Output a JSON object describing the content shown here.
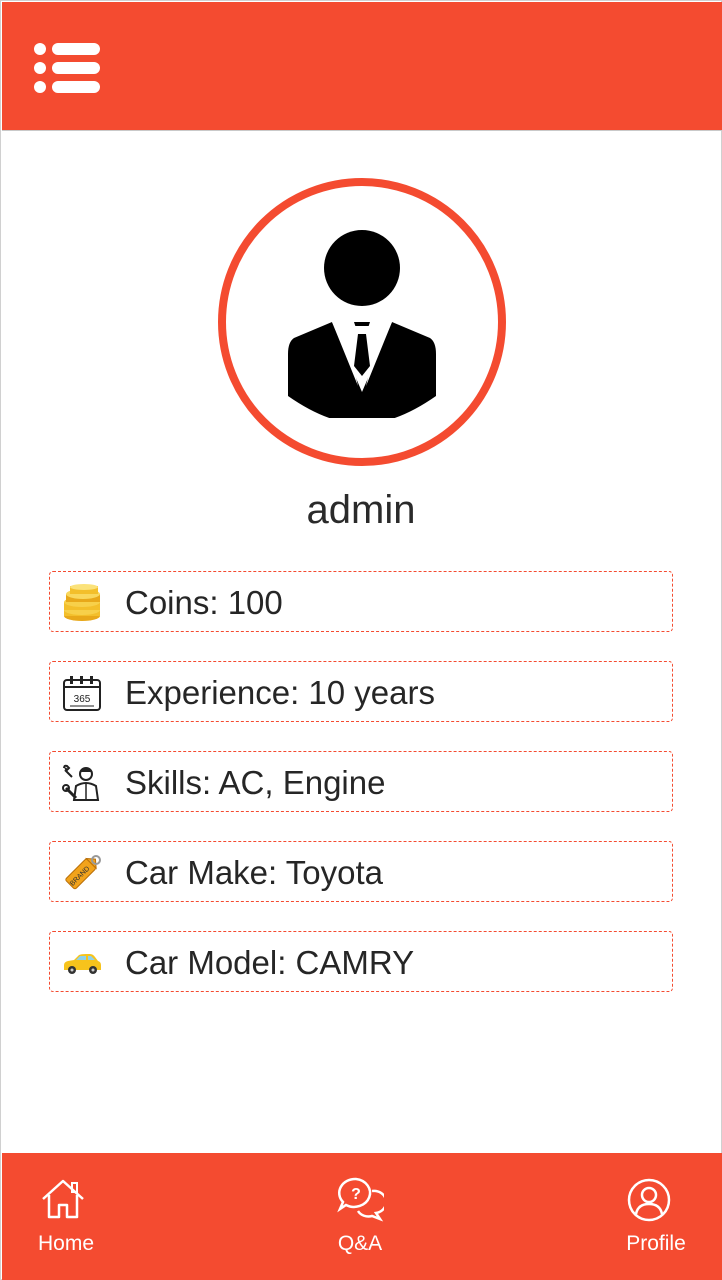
{
  "header": {
    "menu_icon": "list-menu-icon",
    "background": "#f44b30"
  },
  "profile": {
    "avatar_icon": "user-avatar-icon",
    "username": "admin",
    "accent": "#f44b30"
  },
  "info": [
    {
      "icon": "coins-icon",
      "text": "Coins: 100"
    },
    {
      "icon": "calendar-365-icon",
      "text": "Experience: 10 years"
    },
    {
      "icon": "mechanic-icon",
      "text": "Skills: AC, Engine"
    },
    {
      "icon": "brand-tag-icon",
      "text": "Car Make: Toyota"
    },
    {
      "icon": "car-icon",
      "text": "Car Model: CAMRY"
    }
  ],
  "tabbar": {
    "tabs": [
      {
        "icon": "home-icon",
        "label": "Home"
      },
      {
        "icon": "qa-icon",
        "label": "Q&A"
      },
      {
        "icon": "profile-icon",
        "label": "Profile"
      }
    ]
  }
}
